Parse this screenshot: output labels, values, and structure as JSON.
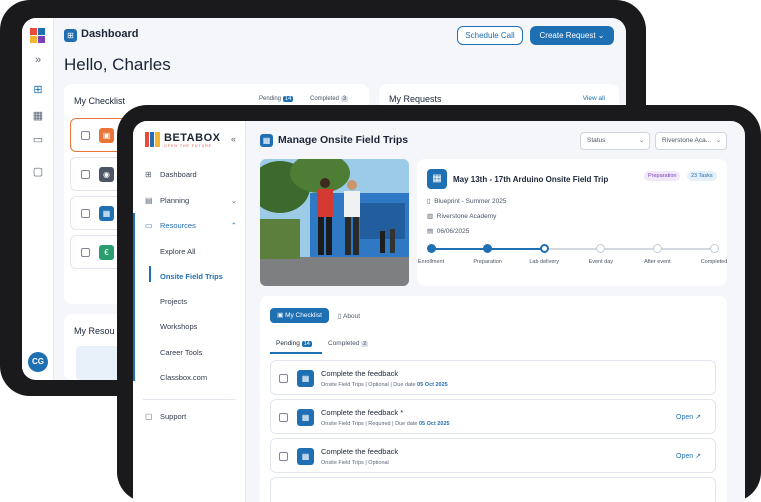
{
  "back": {
    "header_title": "Dashboard",
    "schedule_label": "Schedule Call",
    "create_label": "Create Request",
    "greeting": "Hello, Charles",
    "checklist_title": "My Checklist",
    "pending_label": "Pending",
    "pending_count": "14",
    "completed_label": "Completed",
    "completed_count": "3",
    "requests_title": "My Requests",
    "view_all": "View all",
    "resources_title": "My Resou",
    "avatar_initials": "CG"
  },
  "front": {
    "brand": "BETABOX",
    "brand_tagline": "OPEN THE FUTURE",
    "page_title": "Manage Onsite Field Trips",
    "status_select": "Status",
    "school_select": "Riverstone Aca...",
    "sidebar": {
      "dashboard": "Dashboard",
      "planning": "Planning",
      "resources": "Resources",
      "explore_all": "Explore All",
      "onsite_field_trips": "Onsite Field Trips",
      "projects": "Projects",
      "workshops": "Workshops",
      "career_tools": "Career Tools",
      "classbox": "Classbox.com",
      "support": "Support"
    },
    "trip": {
      "title": "May 13th - 17th Arduino Onsite Field Trip",
      "badge_stage": "Preparation",
      "badge_tasks": "23 Tasks",
      "blueprint": "Blueprint - Summer 2025",
      "school": "Riverstone Academy",
      "date": "06/06/2025",
      "steps": [
        "Enrollment",
        "Preparation",
        "Lab delivery",
        "Event day",
        "After event",
        "Completed"
      ],
      "progress_fraction": 0.4
    },
    "tabs": {
      "checklist": "My Checklist",
      "about": "About",
      "pending": "Pending",
      "pending_count": "14",
      "completed": "Completed",
      "completed_count": "2"
    },
    "tasks": [
      {
        "title": "Complete the feedback",
        "category": "Onsite Field Trips",
        "req": "Optional",
        "due_label": "Due date",
        "due": "05 Oct 2025",
        "open": ""
      },
      {
        "title": "Complete the feedback *",
        "category": "Onsite Field Trips",
        "req": "Required",
        "due_label": "Due date",
        "due": "05 Oct 2025",
        "open": "Open"
      },
      {
        "title": "Complete the feedback",
        "category": "Onsite Field Trips",
        "req": "Optional",
        "due_label": "",
        "due": "",
        "open": "Open"
      }
    ]
  },
  "colors": {
    "accent": "#1f6fb3",
    "badge_purple": "#7b3fb8",
    "orange": "#e8753a",
    "green": "#2a9d6f"
  }
}
